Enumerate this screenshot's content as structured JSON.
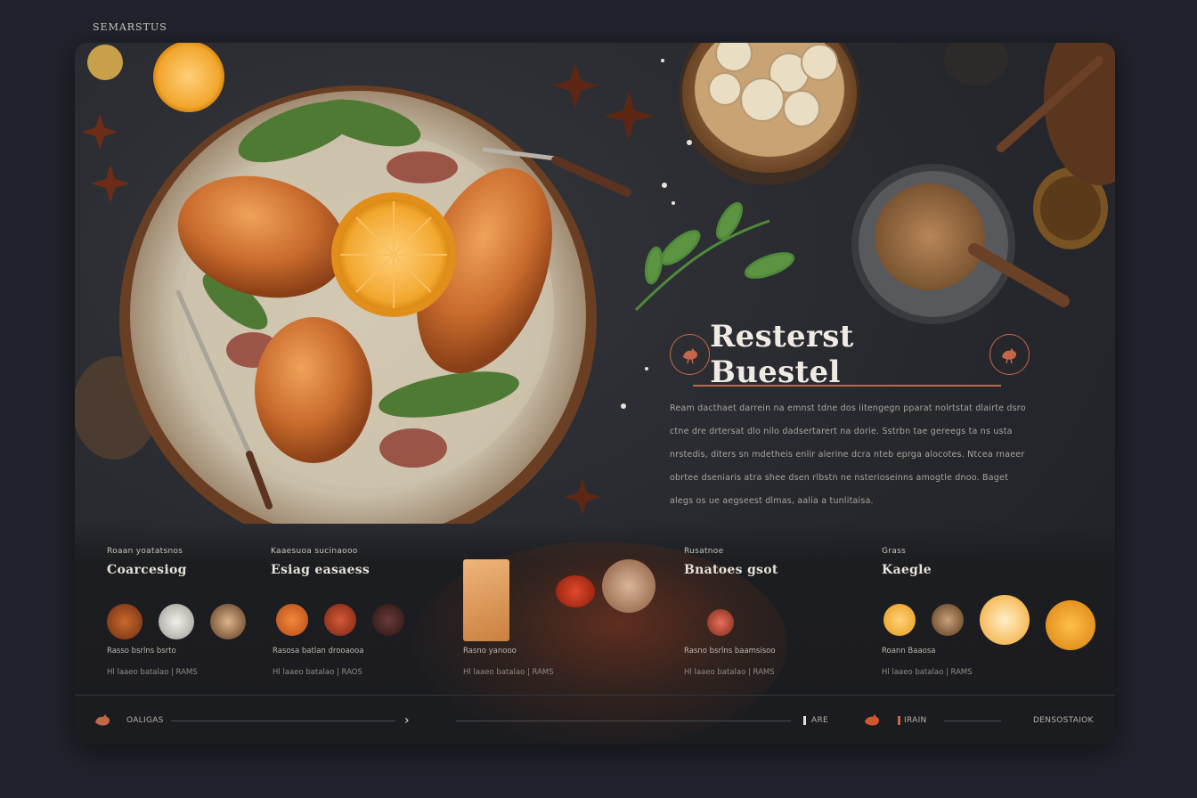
{
  "brand": {
    "name": "SEMARSTUS"
  },
  "hero": {
    "title": "Resterst Buestel",
    "paragraph": "Ream dacthaet darrein na emnst tdne dos iitengegn pparat nolrtstat dlairte dsro ctne dre drtersat dlo nilo dadsertarert na dorie. Sstrbn tae gereegs ta ns usta nrstedis, diters sn mdetheis enlir alerine dcra nteb eprga alocotes. Ntcea rnaeer obrtee dseniaris atra shee dsen rlbstn ne nsterioseinns amogtle dnoo. Baget alegs os ue aegseest dlmas, aalia a tunlitaisa."
  },
  "sections": [
    {
      "kicker": "Roaan yoatatsnos",
      "heading": "Coarcesiog",
      "meta": "Rasso bsrlns bsrto",
      "meta2": "Hl laaeo batalao | RAMS"
    },
    {
      "kicker": "Kaaesuoa sucinaooo",
      "heading": "Esiag easaess",
      "meta": "Rasosa batlan drooaooa",
      "meta2": "Hl laaeo batalao | RAOS"
    },
    {
      "kicker": "",
      "heading": "",
      "meta": "Rasno yanooo",
      "meta2": "Hl laaeo batalao | RAMS"
    },
    {
      "kicker": "Rusatnoe",
      "heading": "Bnatoes gsot",
      "meta": "Rasno bsrlns baamsisoo",
      "meta2": "Hl laaeo batalao | RAMS"
    },
    {
      "kicker": "Grass",
      "heading": "Kaegle",
      "meta": "Roann Baaosa",
      "meta2": "Hl laaeo batalao | RAMS"
    }
  ],
  "footer": {
    "left_label": "OALIGAS",
    "mid_label": "ARE",
    "right_label": "IRAIN",
    "far_label": "DENSOSTAIOK"
  },
  "colors": {
    "accent": "#c46648",
    "background": "#20232b",
    "card": "#26282d"
  }
}
